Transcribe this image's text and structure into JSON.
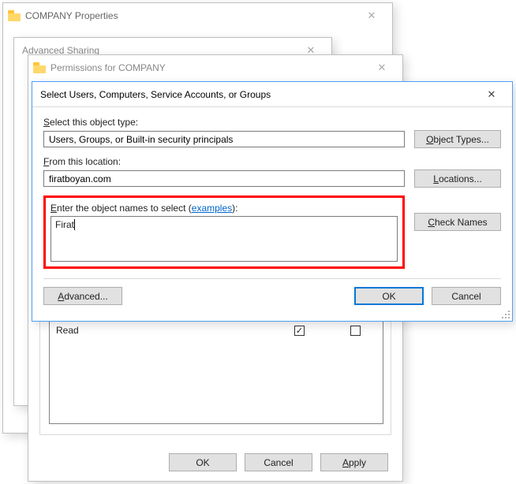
{
  "backwin1": {
    "title": "COMPANY Properties"
  },
  "backwin2": {
    "title": "Advanced Sharing"
  },
  "permwin": {
    "title": "Permissions for COMPANY",
    "perm_read_label": "Read",
    "ok": "OK",
    "cancel": "Cancel",
    "apply": "Apply"
  },
  "dlg": {
    "title": "Select Users, Computers, Service Accounts, or Groups",
    "obj_label": "Select this object type:",
    "obj_value": "Users, Groups, or Built-in security principals",
    "obj_btn": "Object Types...",
    "loc_label": "From this location:",
    "loc_value": "firatboyan.com",
    "loc_btn": "Locations...",
    "names_label_a": "Enter the object names to select (",
    "names_label_link": "examples",
    "names_label_b": "):",
    "names_value": "Firat",
    "check_btn": "Check Names",
    "advanced": "Advanced...",
    "ok": "OK",
    "cancel": "Cancel"
  }
}
